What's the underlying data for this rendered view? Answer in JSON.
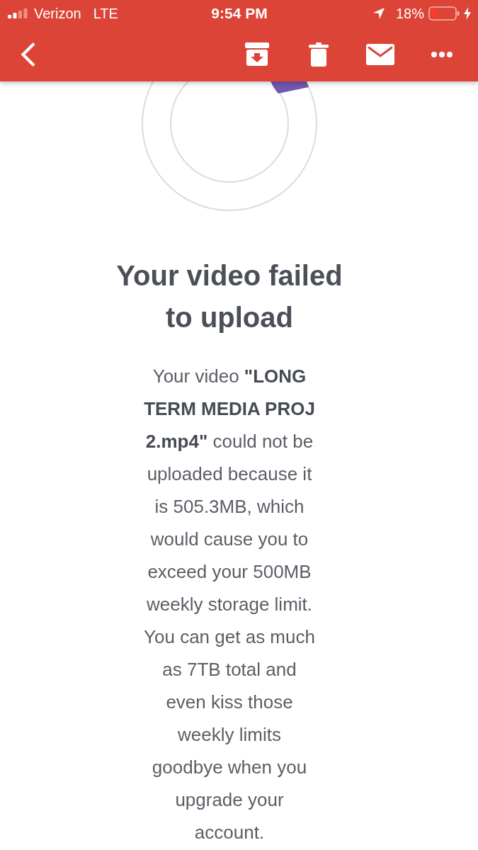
{
  "status_bar": {
    "carrier": "Verizon",
    "network": "LTE",
    "time": "9:54 PM",
    "battery": "18%"
  },
  "message": {
    "title": "Your video failed to upload",
    "body": "Your video **\"LONG TERM MEDIA PROJ 2.mp4\"** could not be uploaded because it is 505.3MB, which would cause you to exceed your 500MB weekly storage limit. You can get as much as 7TB total and even kiss those weekly limits goodbye when you upgrade your account."
  }
}
